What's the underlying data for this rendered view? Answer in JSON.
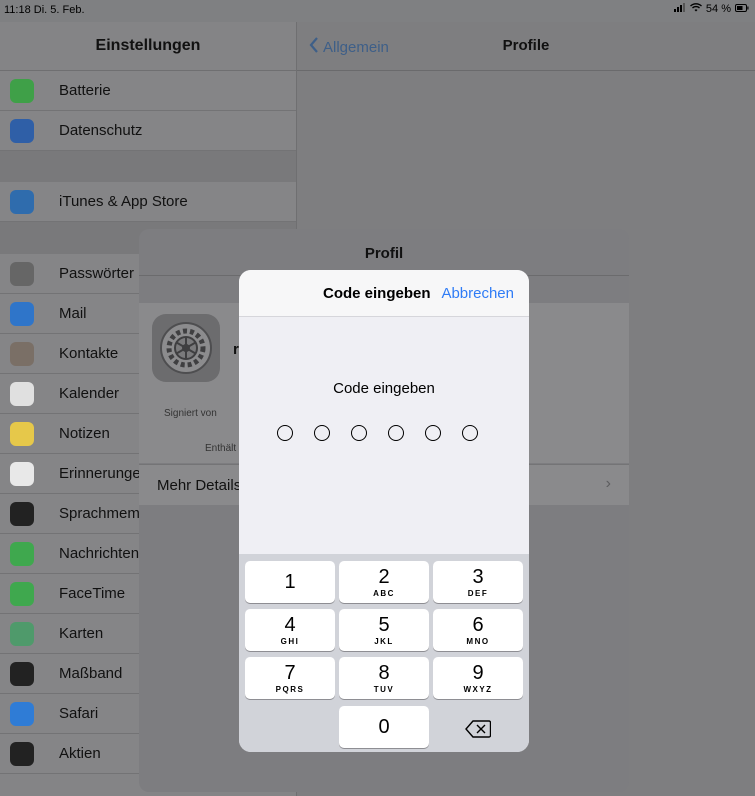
{
  "status": {
    "time": "11:18",
    "date": "Di. 5. Feb.",
    "battery": "54 %"
  },
  "sidebar": {
    "title": "Einstellungen",
    "items": [
      {
        "label": "Batterie",
        "icon": "battery-icon",
        "color": "#3fa048"
      },
      {
        "label": "Datenschutz",
        "icon": "hand-icon",
        "color": "#2f5fa7"
      },
      {
        "label": "iTunes & App Store",
        "icon": "appstore-icon",
        "color": "#2f6cad"
      },
      {
        "label": "Passwörter",
        "icon": "key-icon",
        "color": "#666666"
      },
      {
        "label": "Mail",
        "icon": "mail-icon",
        "color": "#2f75c9"
      },
      {
        "label": "Kontakte",
        "icon": "contacts-icon",
        "color": "#7a6f66"
      },
      {
        "label": "Kalender",
        "icon": "calendar-icon",
        "color": "#e0e0e0"
      },
      {
        "label": "Notizen",
        "icon": "notes-icon",
        "color": "#e6c84a"
      },
      {
        "label": "Erinnerungen",
        "icon": "reminders-icon",
        "color": "#e8e8e8"
      },
      {
        "label": "Sprachmemos",
        "icon": "voice-memos-icon",
        "color": "#222222"
      },
      {
        "label": "Nachrichten",
        "icon": "messages-icon",
        "color": "#3fa84e"
      },
      {
        "label": "FaceTime",
        "icon": "facetime-icon",
        "color": "#3fa84e"
      },
      {
        "label": "Karten",
        "icon": "maps-icon",
        "color": "#4f9a6b"
      },
      {
        "label": "Maßband",
        "icon": "measure-icon",
        "color": "#222222"
      },
      {
        "label": "Safari",
        "icon": "safari-icon",
        "color": "#2f7cd6"
      },
      {
        "label": "Aktien",
        "icon": "stocks-icon",
        "color": "#222222"
      }
    ]
  },
  "detail": {
    "back_label": "Allgemein",
    "title": "Profile"
  },
  "profile_sheet": {
    "title": "Profil",
    "name_initial": "r",
    "signed_label": "Signiert von",
    "contains_label": "Enthält",
    "more_label": "Mehr Details"
  },
  "dialog": {
    "title": "Code eingeben",
    "cancel_label": "Abbrechen",
    "prompt": "Code eingeben",
    "code_length": 6,
    "keys": [
      {
        "num": "1",
        "letters": ""
      },
      {
        "num": "2",
        "letters": "ABC"
      },
      {
        "num": "3",
        "letters": "DEF"
      },
      {
        "num": "4",
        "letters": "GHI"
      },
      {
        "num": "5",
        "letters": "JKL"
      },
      {
        "num": "6",
        "letters": "MNO"
      },
      {
        "num": "7",
        "letters": "PQRS"
      },
      {
        "num": "8",
        "letters": "TUV"
      },
      {
        "num": "9",
        "letters": "WXYZ"
      },
      {
        "num": "0",
        "letters": ""
      }
    ]
  },
  "colors": {
    "accent": "#2f7cf6",
    "keypad_bg": "#d1d3d9"
  }
}
